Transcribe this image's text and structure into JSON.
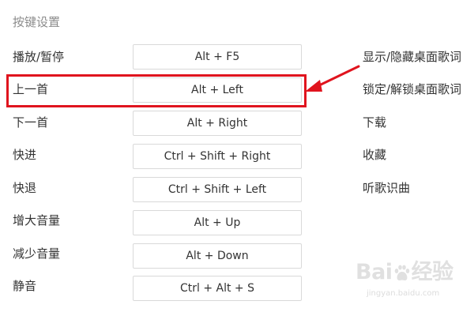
{
  "section_title": "按键设置",
  "rows": [
    {
      "label": "播放/暂停",
      "keys": "Alt + F5"
    },
    {
      "label": "上一首",
      "keys": "Alt + Left"
    },
    {
      "label": "下一首",
      "keys": "Alt + Right"
    },
    {
      "label": "快进",
      "keys": "Ctrl + Shift + Right"
    },
    {
      "label": "快退",
      "keys": "Ctrl + Shift + Left"
    },
    {
      "label": "增大音量",
      "keys": "Alt + Up"
    },
    {
      "label": "减少音量",
      "keys": "Alt + Down"
    },
    {
      "label": "静音",
      "keys": "Ctrl + Alt + S"
    }
  ],
  "right_items": [
    "显示/隐藏桌面歌词",
    "锁定/解锁桌面歌词",
    "下载",
    "收藏",
    "听歌识曲"
  ],
  "annotation": {
    "color": "#e0141e"
  },
  "watermark": {
    "logo_left": "Bai",
    "logo_right": "经验",
    "url": "jingyan.baidu.com"
  }
}
